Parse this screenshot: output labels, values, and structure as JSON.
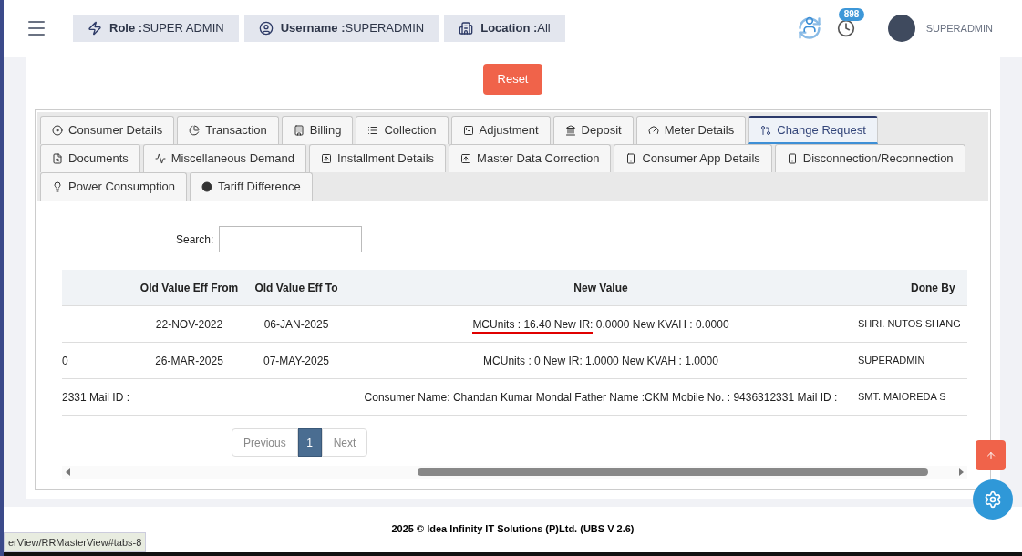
{
  "header": {
    "chips": [
      {
        "kind": "role",
        "label": "Role :",
        "value": "SUPER ADMIN"
      },
      {
        "kind": "user",
        "label": "Username :",
        "value": "SUPERADMIN"
      },
      {
        "kind": "location",
        "label": "Location :",
        "value": "All"
      }
    ],
    "notification_count": "898",
    "user_name": "SUPERADMIN"
  },
  "reset_button": "Reset",
  "tabs": [
    [
      {
        "label": "Consumer Details",
        "selected": false
      },
      {
        "label": "Transaction",
        "selected": false
      },
      {
        "label": "Billing",
        "selected": false
      },
      {
        "label": "Collection",
        "selected": false
      },
      {
        "label": "Adjustment",
        "selected": false
      },
      {
        "label": "Deposit",
        "selected": false
      },
      {
        "label": "Meter Details",
        "selected": false
      },
      {
        "label": "Change Request",
        "selected": true
      }
    ],
    [
      {
        "label": "Documents",
        "selected": false
      },
      {
        "label": "Miscellaneous Demand",
        "selected": false
      },
      {
        "label": "Installment Details",
        "selected": false
      },
      {
        "label": "Master Data Correction",
        "selected": false
      },
      {
        "label": "Consumer App Details",
        "selected": false
      },
      {
        "label": "Disconnection/Reconnection",
        "selected": false
      }
    ],
    [
      {
        "label": "Power Consumption",
        "selected": false
      },
      {
        "label": "Tariff Difference",
        "selected": false
      }
    ]
  ],
  "search": {
    "label": "Search:"
  },
  "table": {
    "columns": [
      "Old Value Eff From",
      "Old Value Eff To",
      "New Value",
      "Done By"
    ],
    "rows": [
      {
        "from": "22-NOV-2022",
        "to": "06-JAN-2025",
        "new_value": [
          {
            "text": "MCUnits : 16.40 New IR:",
            "underlined": true
          },
          {
            "text": " 0.0000 New KVAH : 0.0000",
            "underlined": false
          }
        ],
        "done_by": "SHRI. NUTOS SHANG"
      },
      {
        "column_1": "0",
        "from": "26-MAR-2025",
        "to": "07-MAY-2025",
        "new_value": [
          {
            "text": "MCUnits : 0 New IR: 1.0000 New KVAH : 1.0000",
            "underlined": false
          }
        ],
        "done_by": "SUPERADMIN"
      },
      {
        "column_1": "2331 Mail ID :",
        "new_value": [
          {
            "text": "Consumer Name: Chandan Kumar Mondal Father Name :CKM Mobile No. : 9436312331 Mail ID :",
            "underlined": false
          }
        ],
        "done_by": "SMT. MAIOREDA S"
      }
    ]
  },
  "pagination": {
    "previous": "Previous",
    "pages": [
      {
        "label": "1",
        "selected": true
      }
    ],
    "next": "Next"
  },
  "footer": "2025 © Idea Infinity IT Solutions (P)Ltd. (UBS V 2.6)",
  "status_url": "erView/RRMasterView#tabs-8"
}
